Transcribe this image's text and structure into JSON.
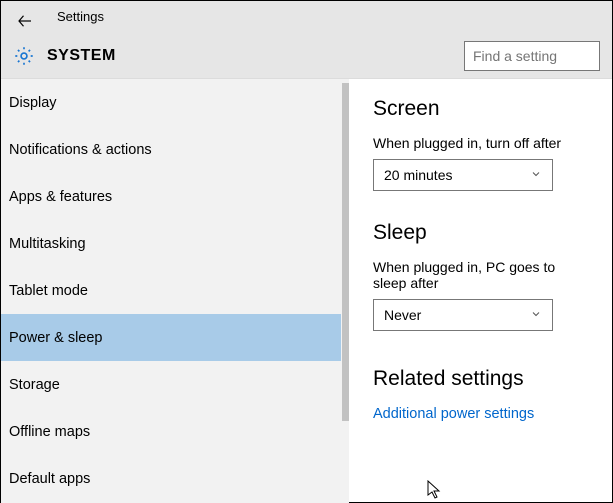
{
  "header": {
    "app_title": "Settings",
    "section_title": "SYSTEM",
    "search_placeholder": "Find a setting"
  },
  "sidebar": {
    "selected_index": 5,
    "items": [
      {
        "label": "Display"
      },
      {
        "label": "Notifications & actions"
      },
      {
        "label": "Apps & features"
      },
      {
        "label": "Multitasking"
      },
      {
        "label": "Tablet mode"
      },
      {
        "label": "Power & sleep"
      },
      {
        "label": "Storage"
      },
      {
        "label": "Offline maps"
      },
      {
        "label": "Default apps"
      }
    ]
  },
  "content": {
    "screen": {
      "heading": "Screen",
      "plugged_label": "When plugged in, turn off after",
      "plugged_value": "20 minutes"
    },
    "sleep": {
      "heading": "Sleep",
      "plugged_label": "When plugged in, PC goes to sleep after",
      "plugged_value": "Never"
    },
    "related": {
      "heading": "Related settings",
      "link_label": "Additional power settings"
    }
  }
}
